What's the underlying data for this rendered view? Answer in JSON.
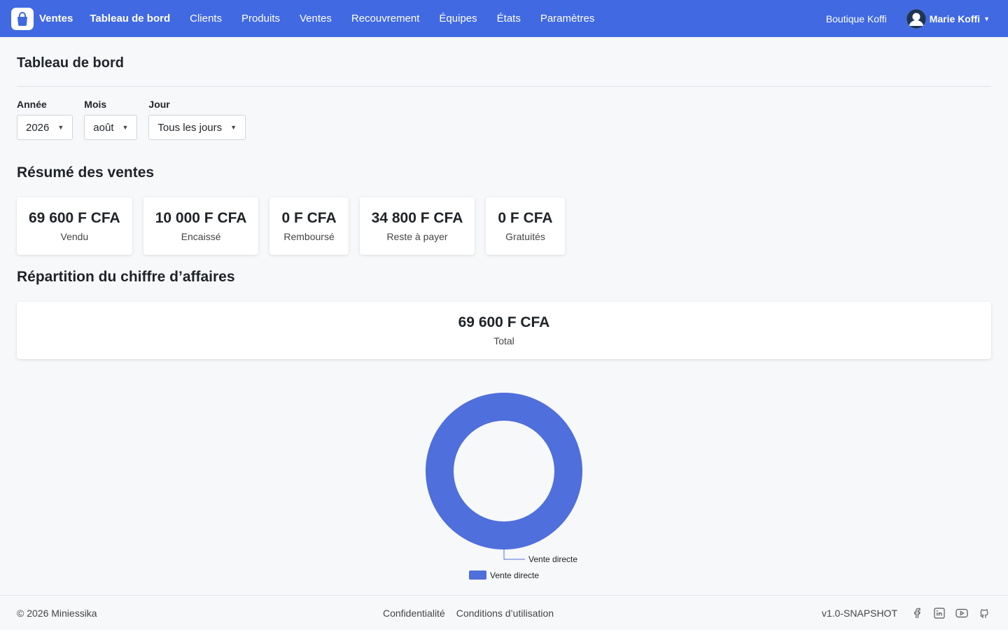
{
  "app": {
    "brand": "Ventes",
    "nav": [
      "Tableau de bord",
      "Clients",
      "Produits",
      "Ventes",
      "Recouvrement",
      "Équipes",
      "États",
      "Paramètres"
    ],
    "active_nav": "Tableau de bord",
    "shop": "Boutique Koffi",
    "user": "Marie Koffi",
    "accent": "#4169e1"
  },
  "page": {
    "title": "Tableau de bord"
  },
  "filters": {
    "year_label": "Année",
    "year_value": "2026",
    "month_label": "Mois",
    "month_value": "août",
    "day_label": "Jour",
    "day_value": "Tous les jours"
  },
  "summary": {
    "title": "Résumé des ventes",
    "cards": [
      {
        "value": "69 600 F CFA",
        "label": "Vendu"
      },
      {
        "value": "10 000 F CFA",
        "label": "Encaissé"
      },
      {
        "value": "0 F CFA",
        "label": "Remboursé"
      },
      {
        "value": "34 800 F CFA",
        "label": "Reste à payer"
      },
      {
        "value": "0 F CFA",
        "label": "Gratuités"
      }
    ]
  },
  "breakdown": {
    "title": "Répartition du chiffre d’affaires",
    "total_value": "69 600 F CFA",
    "total_label": "Total"
  },
  "chart_data": {
    "type": "pie",
    "categories": [
      "Vente directe"
    ],
    "values": [
      69600
    ],
    "colors": [
      "#4f6fdc"
    ],
    "legend": "bottom"
  },
  "footer": {
    "copyright": "© 2026 Miniessika",
    "links": [
      "Confidentialité",
      "Conditions d’utilisation"
    ],
    "version": "v1.0-SNAPSHOT",
    "socials": [
      "facebook-icon",
      "linkedin-icon",
      "youtube-icon",
      "github-icon"
    ]
  }
}
